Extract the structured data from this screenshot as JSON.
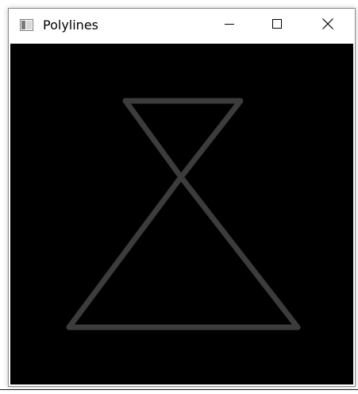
{
  "window": {
    "title": "Polylines",
    "icon": "app-window-icon",
    "controls": {
      "minimize_icon": "minimize-icon",
      "maximize_icon": "maximize-icon",
      "close_icon": "close-icon"
    }
  },
  "canvas": {
    "background": "#000000",
    "stroke_color": "#3c3c3c",
    "shapes": [
      {
        "name": "upper-triangle-polyline",
        "type": "polyline"
      },
      {
        "name": "lower-triangle-polyline",
        "type": "polyline"
      }
    ]
  }
}
